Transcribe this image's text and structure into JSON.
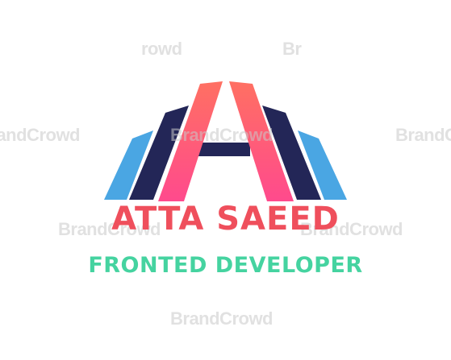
{
  "logo": {
    "monogram_icon": "letter-a-monogram-icon",
    "name": "ATTA SAEED",
    "tagline": "FRONTED DEVELOPER",
    "colors": {
      "name": "#ef4f5c",
      "tagline": "#45d3a0",
      "stripe_light_blue": "#4ca6e2",
      "stripe_navy": "#232657",
      "letter_gradient_top": "#ff6f61",
      "letter_gradient_bottom": "#ff4f8b"
    }
  },
  "watermark": {
    "text": "BrandCrowd",
    "partials": [
      "rowd",
      "Br"
    ]
  }
}
